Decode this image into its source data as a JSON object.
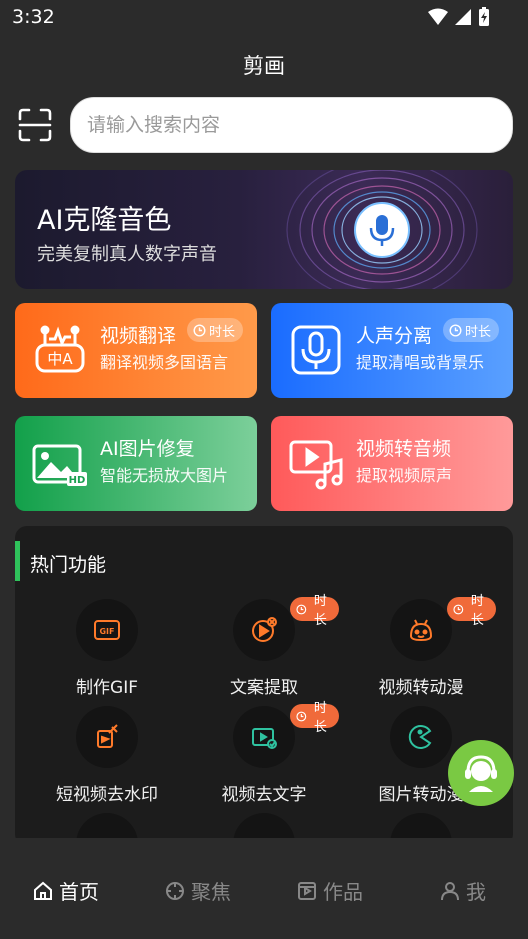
{
  "status": {
    "time": "3:32"
  },
  "app": {
    "title": "剪画"
  },
  "search": {
    "placeholder": "请输入搜索内容"
  },
  "banner": {
    "title": "AI克隆音色",
    "subtitle": "完美复制真人数字声音"
  },
  "cards": [
    {
      "title": "视频翻译",
      "subtitle": "翻译视频多国语言",
      "badge": "时长",
      "icon": "translate-robot-icon"
    },
    {
      "title": "人声分离",
      "subtitle": "提取清唱或背景乐",
      "badge": "时长",
      "icon": "microphone-icon"
    },
    {
      "title": "AI图片修复",
      "subtitle": "智能无损放大图片",
      "icon": "hd-image-icon"
    },
    {
      "title": "视频转音频",
      "subtitle": "提取视频原声",
      "icon": "video-to-audio-icon"
    }
  ],
  "hot": {
    "title": "热门功能",
    "items": [
      {
        "label": "制作GIF",
        "icon": "gif-icon"
      },
      {
        "label": "文案提取",
        "icon": "text-extract-icon",
        "badge": "时长"
      },
      {
        "label": "视频转动漫",
        "icon": "anime-face-icon",
        "badge": "时长"
      },
      {
        "label": "短视频去水印",
        "icon": "watermark-remove-icon"
      },
      {
        "label": "视频去文字",
        "icon": "video-text-remove-icon",
        "badge": "时长"
      },
      {
        "label": "图片转动漫",
        "icon": "pacman-icon"
      }
    ]
  },
  "nav": [
    {
      "label": "首页",
      "icon": "home-icon",
      "active": true
    },
    {
      "label": "聚焦",
      "icon": "focus-icon"
    },
    {
      "label": "作品",
      "icon": "works-icon"
    },
    {
      "label": "我",
      "icon": "profile-icon"
    }
  ],
  "colors": {
    "accent_green": "#2fc25b",
    "badge_orange": "#f06a3a",
    "fab": "#7ac943"
  }
}
